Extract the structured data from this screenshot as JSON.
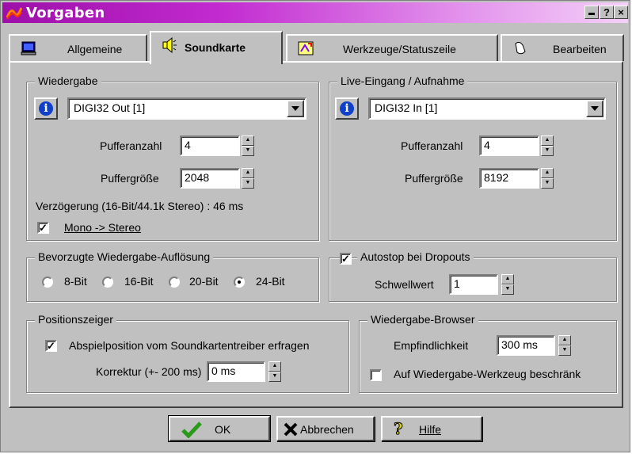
{
  "window": {
    "title": "Vorgaben"
  },
  "titlebar_buttons": {
    "minimize": "_",
    "help": "?",
    "close": "×"
  },
  "tabs": [
    {
      "label": "Allgemeine",
      "icon": "monitor-icon",
      "active": false
    },
    {
      "label": "Soundkarte",
      "icon": "speaker-icon",
      "active": true
    },
    {
      "label": "Werkzeuge/Statuszeile",
      "icon": "tools-icon",
      "active": false
    },
    {
      "label": "Bearbeiten",
      "icon": "edit-hand-icon",
      "active": false
    }
  ],
  "playback": {
    "group_title": "Wiedergabe",
    "device": "DIGI32 Out [1]",
    "buffer_count_label": "Pufferanzahl",
    "buffer_count": "4",
    "buffer_size_label": "Puffergröße",
    "buffer_size": "2048",
    "latency_text": "Verzögerung (16-Bit/44.1k Stereo) : 46 ms",
    "mono_stereo_label": "Mono -> Stereo",
    "mono_stereo_checked": true
  },
  "record": {
    "group_title": "Live-Eingang / Aufnahme",
    "device": "DIGI32 In [1]",
    "buffer_count_label": "Pufferanzahl",
    "buffer_count": "4",
    "buffer_size_label": "Puffergröße",
    "buffer_size": "8192"
  },
  "resolution": {
    "group_title": "Bevorzugte Wiedergabe-Auflösung",
    "options": [
      "8-Bit",
      "16-Bit",
      "20-Bit",
      "24-Bit"
    ],
    "selected": "24-Bit"
  },
  "autostop": {
    "label": "Autostop bei Dropouts",
    "checked": true,
    "threshold_label": "Schwellwert",
    "threshold": "1"
  },
  "position": {
    "group_title": "Positionszeiger",
    "query_label": "Abspielposition vom Soundkartentreiber erfragen",
    "query_checked": true,
    "correction_label": "Korrektur (+- 200 ms)",
    "correction": "0 ms"
  },
  "browser": {
    "group_title": "Wiedergabe-Browser",
    "sensitivity_label": "Empfindlichkeit",
    "sensitivity": "300 ms",
    "restrict_label": "Auf Wiedergabe-Werkzeug beschränk",
    "restrict_checked": false
  },
  "buttons": {
    "ok": "OK",
    "cancel": "Abbrechen",
    "help": "Hilfe"
  },
  "colors": {
    "titlebar": "#9d0fa8",
    "face": "#c0c0c0",
    "info": "#1040c8",
    "ok_check": "#2a9a1a",
    "cancel_x": "#000000",
    "help_q": "#d8d800"
  }
}
